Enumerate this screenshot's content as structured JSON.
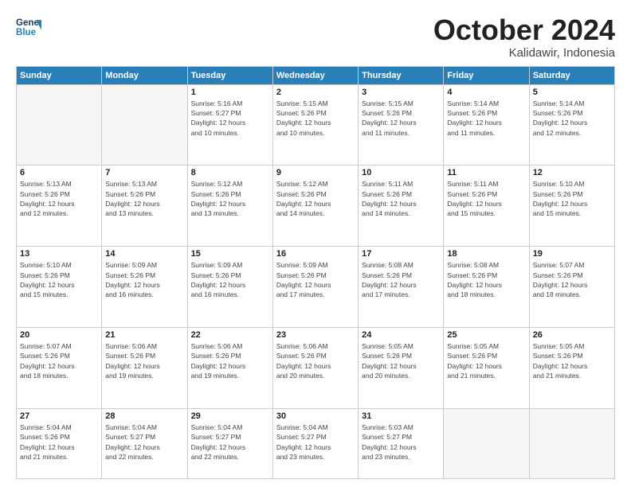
{
  "logo": {
    "line1": "General",
    "line2": "Blue"
  },
  "title": "October 2024",
  "subtitle": "Kalidawir, Indonesia",
  "days_header": [
    "Sunday",
    "Monday",
    "Tuesday",
    "Wednesday",
    "Thursday",
    "Friday",
    "Saturday"
  ],
  "weeks": [
    [
      {
        "day": "",
        "info": ""
      },
      {
        "day": "",
        "info": ""
      },
      {
        "day": "1",
        "info": "Sunrise: 5:16 AM\nSunset: 5:27 PM\nDaylight: 12 hours\nand 10 minutes."
      },
      {
        "day": "2",
        "info": "Sunrise: 5:15 AM\nSunset: 5:26 PM\nDaylight: 12 hours\nand 10 minutes."
      },
      {
        "day": "3",
        "info": "Sunrise: 5:15 AM\nSunset: 5:26 PM\nDaylight: 12 hours\nand 11 minutes."
      },
      {
        "day": "4",
        "info": "Sunrise: 5:14 AM\nSunset: 5:26 PM\nDaylight: 12 hours\nand 11 minutes."
      },
      {
        "day": "5",
        "info": "Sunrise: 5:14 AM\nSunset: 5:26 PM\nDaylight: 12 hours\nand 12 minutes."
      }
    ],
    [
      {
        "day": "6",
        "info": "Sunrise: 5:13 AM\nSunset: 5:26 PM\nDaylight: 12 hours\nand 12 minutes."
      },
      {
        "day": "7",
        "info": "Sunrise: 5:13 AM\nSunset: 5:26 PM\nDaylight: 12 hours\nand 13 minutes."
      },
      {
        "day": "8",
        "info": "Sunrise: 5:12 AM\nSunset: 5:26 PM\nDaylight: 12 hours\nand 13 minutes."
      },
      {
        "day": "9",
        "info": "Sunrise: 5:12 AM\nSunset: 5:26 PM\nDaylight: 12 hours\nand 14 minutes."
      },
      {
        "day": "10",
        "info": "Sunrise: 5:11 AM\nSunset: 5:26 PM\nDaylight: 12 hours\nand 14 minutes."
      },
      {
        "day": "11",
        "info": "Sunrise: 5:11 AM\nSunset: 5:26 PM\nDaylight: 12 hours\nand 15 minutes."
      },
      {
        "day": "12",
        "info": "Sunrise: 5:10 AM\nSunset: 5:26 PM\nDaylight: 12 hours\nand 15 minutes."
      }
    ],
    [
      {
        "day": "13",
        "info": "Sunrise: 5:10 AM\nSunset: 5:26 PM\nDaylight: 12 hours\nand 15 minutes."
      },
      {
        "day": "14",
        "info": "Sunrise: 5:09 AM\nSunset: 5:26 PM\nDaylight: 12 hours\nand 16 minutes."
      },
      {
        "day": "15",
        "info": "Sunrise: 5:09 AM\nSunset: 5:26 PM\nDaylight: 12 hours\nand 16 minutes."
      },
      {
        "day": "16",
        "info": "Sunrise: 5:09 AM\nSunset: 5:26 PM\nDaylight: 12 hours\nand 17 minutes."
      },
      {
        "day": "17",
        "info": "Sunrise: 5:08 AM\nSunset: 5:26 PM\nDaylight: 12 hours\nand 17 minutes."
      },
      {
        "day": "18",
        "info": "Sunrise: 5:08 AM\nSunset: 5:26 PM\nDaylight: 12 hours\nand 18 minutes."
      },
      {
        "day": "19",
        "info": "Sunrise: 5:07 AM\nSunset: 5:26 PM\nDaylight: 12 hours\nand 18 minutes."
      }
    ],
    [
      {
        "day": "20",
        "info": "Sunrise: 5:07 AM\nSunset: 5:26 PM\nDaylight: 12 hours\nand 18 minutes."
      },
      {
        "day": "21",
        "info": "Sunrise: 5:06 AM\nSunset: 5:26 PM\nDaylight: 12 hours\nand 19 minutes."
      },
      {
        "day": "22",
        "info": "Sunrise: 5:06 AM\nSunset: 5:26 PM\nDaylight: 12 hours\nand 19 minutes."
      },
      {
        "day": "23",
        "info": "Sunrise: 5:06 AM\nSunset: 5:26 PM\nDaylight: 12 hours\nand 20 minutes."
      },
      {
        "day": "24",
        "info": "Sunrise: 5:05 AM\nSunset: 5:26 PM\nDaylight: 12 hours\nand 20 minutes."
      },
      {
        "day": "25",
        "info": "Sunrise: 5:05 AM\nSunset: 5:26 PM\nDaylight: 12 hours\nand 21 minutes."
      },
      {
        "day": "26",
        "info": "Sunrise: 5:05 AM\nSunset: 5:26 PM\nDaylight: 12 hours\nand 21 minutes."
      }
    ],
    [
      {
        "day": "27",
        "info": "Sunrise: 5:04 AM\nSunset: 5:26 PM\nDaylight: 12 hours\nand 21 minutes."
      },
      {
        "day": "28",
        "info": "Sunrise: 5:04 AM\nSunset: 5:27 PM\nDaylight: 12 hours\nand 22 minutes."
      },
      {
        "day": "29",
        "info": "Sunrise: 5:04 AM\nSunset: 5:27 PM\nDaylight: 12 hours\nand 22 minutes."
      },
      {
        "day": "30",
        "info": "Sunrise: 5:04 AM\nSunset: 5:27 PM\nDaylight: 12 hours\nand 23 minutes."
      },
      {
        "day": "31",
        "info": "Sunrise: 5:03 AM\nSunset: 5:27 PM\nDaylight: 12 hours\nand 23 minutes."
      },
      {
        "day": "",
        "info": ""
      },
      {
        "day": "",
        "info": ""
      }
    ]
  ]
}
